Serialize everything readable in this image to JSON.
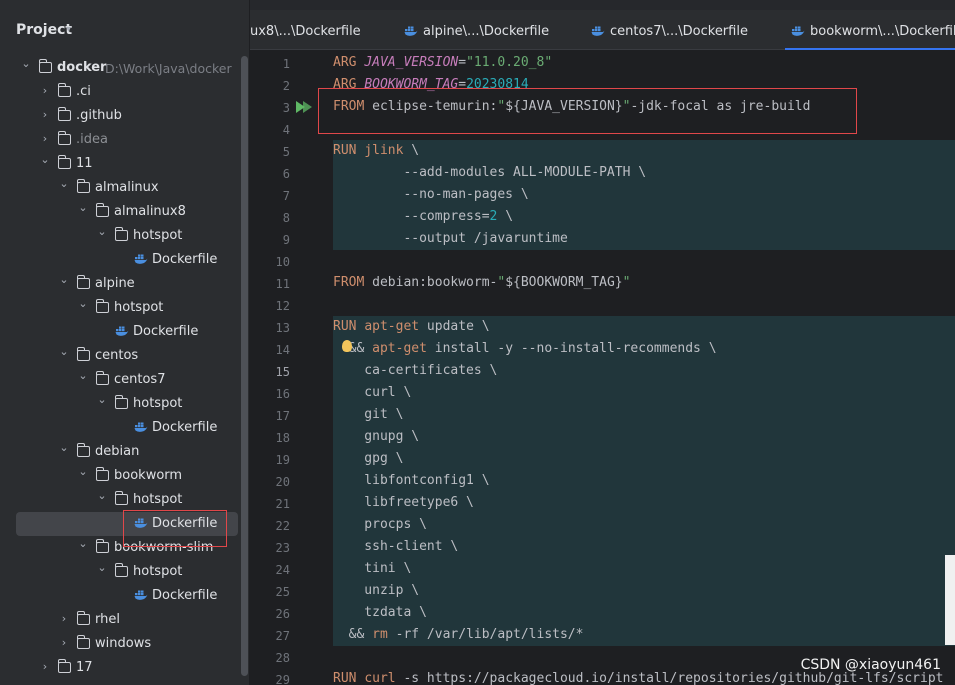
{
  "project_panel": {
    "title": "Project",
    "tree": [
      {
        "label": "docker",
        "path": "D:\\Work\\Java\\docker",
        "depth": 0,
        "expanded": true,
        "type": "root"
      },
      {
        "label": ".ci",
        "depth": 1,
        "expanded": false,
        "type": "folder"
      },
      {
        "label": ".github",
        "depth": 1,
        "expanded": false,
        "type": "folder"
      },
      {
        "label": ".idea",
        "depth": 1,
        "expanded": false,
        "type": "folder",
        "muted": true
      },
      {
        "label": "11",
        "depth": 1,
        "expanded": true,
        "type": "folder"
      },
      {
        "label": "almalinux",
        "depth": 2,
        "expanded": true,
        "type": "folder"
      },
      {
        "label": "almalinux8",
        "depth": 3,
        "expanded": true,
        "type": "folder"
      },
      {
        "label": "hotspot",
        "depth": 4,
        "expanded": true,
        "type": "folder"
      },
      {
        "label": "Dockerfile",
        "depth": 5,
        "type": "file"
      },
      {
        "label": "alpine",
        "depth": 2,
        "expanded": true,
        "type": "folder"
      },
      {
        "label": "hotspot",
        "depth": 3,
        "expanded": true,
        "type": "folder"
      },
      {
        "label": "Dockerfile",
        "depth": 4,
        "type": "file"
      },
      {
        "label": "centos",
        "depth": 2,
        "expanded": true,
        "type": "folder"
      },
      {
        "label": "centos7",
        "depth": 3,
        "expanded": true,
        "type": "folder"
      },
      {
        "label": "hotspot",
        "depth": 4,
        "expanded": true,
        "type": "folder"
      },
      {
        "label": "Dockerfile",
        "depth": 5,
        "type": "file"
      },
      {
        "label": "debian",
        "depth": 2,
        "expanded": true,
        "type": "folder"
      },
      {
        "label": "bookworm",
        "depth": 3,
        "expanded": true,
        "type": "folder"
      },
      {
        "label": "hotspot",
        "depth": 4,
        "expanded": true,
        "type": "folder"
      },
      {
        "label": "Dockerfile",
        "depth": 5,
        "type": "file",
        "selected": true
      },
      {
        "label": "bookworm-slim",
        "depth": 3,
        "expanded": true,
        "type": "folder"
      },
      {
        "label": "hotspot",
        "depth": 4,
        "expanded": true,
        "type": "folder"
      },
      {
        "label": "Dockerfile",
        "depth": 5,
        "type": "file"
      },
      {
        "label": "rhel",
        "depth": 2,
        "expanded": false,
        "type": "folder"
      },
      {
        "label": "windows",
        "depth": 2,
        "expanded": false,
        "type": "folder"
      },
      {
        "label": "17",
        "depth": 1,
        "expanded": false,
        "type": "folder"
      }
    ]
  },
  "tabs": [
    {
      "label": "ux8\\...\\Dockerfile",
      "icon": false
    },
    {
      "label": "alpine\\...\\Dockerfile",
      "icon": true
    },
    {
      "label": "centos7\\...\\Dockerfile",
      "icon": true
    },
    {
      "label": "bookworm\\...\\Dockerfile",
      "icon": true,
      "active": true
    }
  ],
  "editor": {
    "current_line": 15,
    "lines": [
      {
        "n": "1",
        "parts": [
          [
            "kw",
            "ARG "
          ],
          [
            "it",
            "JAVA_VERSION"
          ],
          [
            "tx",
            "="
          ],
          [
            "str",
            "\"11.0.20_8\""
          ]
        ]
      },
      {
        "n": "2",
        "parts": [
          [
            "kw",
            "ARG "
          ],
          [
            "it",
            "BOOKWORM_TAG"
          ],
          [
            "tx",
            "="
          ],
          [
            "num",
            "20230814"
          ]
        ]
      },
      {
        "n": "3",
        "parts": [
          [
            "kw",
            "FROM "
          ],
          [
            "tx",
            "eclipse-temurin:"
          ],
          [
            "str",
            "\""
          ],
          [
            "tx",
            "${JAVA_VERSION}"
          ],
          [
            "str",
            "\""
          ],
          [
            "tx",
            "-jdk-focal as jre-build"
          ]
        ]
      },
      {
        "n": "4",
        "parts": []
      },
      {
        "n": "5",
        "parts": [
          [
            "kw",
            "RUN "
          ],
          [
            "cmd",
            "jlink"
          ],
          [
            "tx",
            " \\"
          ]
        ]
      },
      {
        "n": "6",
        "parts": [
          [
            "tx",
            "         --add-modules ALL-MODULE-PATH \\"
          ]
        ]
      },
      {
        "n": "7",
        "parts": [
          [
            "tx",
            "         --no-man-pages \\"
          ]
        ]
      },
      {
        "n": "8",
        "parts": [
          [
            "tx",
            "         --compress="
          ],
          [
            "num",
            "2"
          ],
          [
            "tx",
            " \\"
          ]
        ]
      },
      {
        "n": "9",
        "parts": [
          [
            "tx",
            "         --output /javaruntime"
          ]
        ]
      },
      {
        "n": "10",
        "parts": []
      },
      {
        "n": "11",
        "parts": [
          [
            "kw",
            "FROM "
          ],
          [
            "tx",
            "debian:bookworm-"
          ],
          [
            "str",
            "\""
          ],
          [
            "tx",
            "${BOOKWORM_TAG}"
          ],
          [
            "str",
            "\""
          ]
        ]
      },
      {
        "n": "12",
        "parts": []
      },
      {
        "n": "13",
        "parts": [
          [
            "kw",
            "RUN "
          ],
          [
            "cmd",
            "apt-get"
          ],
          [
            "tx",
            " update \\"
          ]
        ]
      },
      {
        "n": "14",
        "parts": [
          [
            "tx",
            "  && "
          ],
          [
            "cmd",
            "apt-get"
          ],
          [
            "tx",
            " install -y --no-install-recommends \\"
          ]
        ]
      },
      {
        "n": "15",
        "parts": [
          [
            "tx",
            "    ca-certificates \\"
          ]
        ]
      },
      {
        "n": "16",
        "parts": [
          [
            "tx",
            "    curl \\"
          ]
        ]
      },
      {
        "n": "17",
        "parts": [
          [
            "tx",
            "    git \\"
          ]
        ]
      },
      {
        "n": "18",
        "parts": [
          [
            "tx",
            "    gnupg \\"
          ]
        ]
      },
      {
        "n": "19",
        "parts": [
          [
            "tx",
            "    gpg \\"
          ]
        ]
      },
      {
        "n": "20",
        "parts": [
          [
            "tx",
            "    libfontconfig1 \\"
          ]
        ]
      },
      {
        "n": "21",
        "parts": [
          [
            "tx",
            "    libfreetype6 \\"
          ]
        ]
      },
      {
        "n": "22",
        "parts": [
          [
            "tx",
            "    procps \\"
          ]
        ]
      },
      {
        "n": "23",
        "parts": [
          [
            "tx",
            "    ssh-client \\"
          ]
        ]
      },
      {
        "n": "24",
        "parts": [
          [
            "tx",
            "    tini \\"
          ]
        ]
      },
      {
        "n": "25",
        "parts": [
          [
            "tx",
            "    unzip \\"
          ]
        ]
      },
      {
        "n": "26",
        "parts": [
          [
            "tx",
            "    tzdata \\"
          ]
        ]
      },
      {
        "n": "27",
        "parts": [
          [
            "tx",
            "  && "
          ],
          [
            "cmd",
            "rm"
          ],
          [
            "tx",
            " -rf /var/lib/apt/lists/*"
          ]
        ]
      },
      {
        "n": "28",
        "parts": []
      },
      {
        "n": "29",
        "parts": [
          [
            "kw",
            "RUN "
          ],
          [
            "cmd",
            "curl"
          ],
          [
            "tx",
            " -s https://packagecloud.io/install/repositories/github/git-lfs/script"
          ]
        ]
      }
    ]
  },
  "watermark": "CSDN @xiaoyun461",
  "colors": {
    "accent": "#3574f0",
    "highlight_box": "#e0474a",
    "keyword": "#cf8e6d",
    "string": "#6aab73",
    "number": "#2aacb8"
  }
}
